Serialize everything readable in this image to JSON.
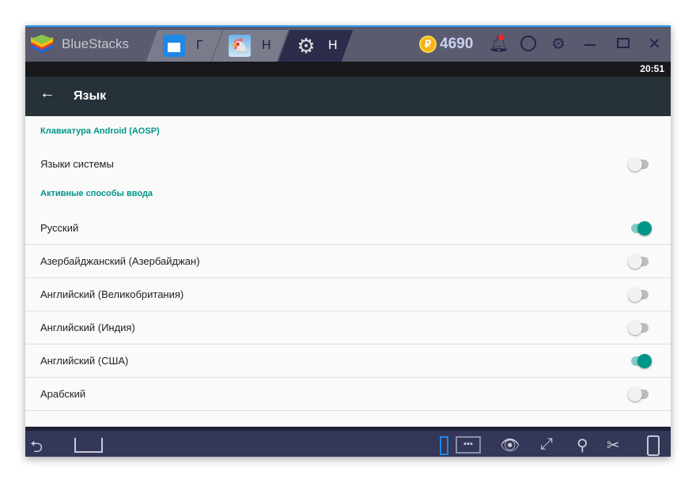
{
  "titlebar": {
    "brand": "BlueStacks",
    "tabs": [
      {
        "label": "Г",
        "icon": "home-icon"
      },
      {
        "label": "Н",
        "icon": "chicken-game-icon"
      },
      {
        "label": "Н",
        "icon": "settings-gear-icon"
      }
    ],
    "coins": "4690",
    "coin_symbol": "₽"
  },
  "status": {
    "time": "20:51"
  },
  "appbar": {
    "title": "Язык"
  },
  "content": {
    "section1": "Клавиатура Android (AOSP)",
    "system_languages": {
      "label": "Языки системы",
      "on": false
    },
    "section2": "Активные способы ввода",
    "items": [
      {
        "label": "Русский",
        "on": true
      },
      {
        "label": "Азербайджанский (Азербайджан)",
        "on": false
      },
      {
        "label": "Английский (Великобритания)",
        "on": false
      },
      {
        "label": "Английский (Индия)",
        "on": false
      },
      {
        "label": "Английский (США)",
        "on": true
      },
      {
        "label": "Арабский",
        "on": false
      }
    ]
  },
  "colors": {
    "accent": "#009688",
    "appbar": "#263238",
    "titlebar": "#5a5b6e",
    "navbar": "#343757"
  }
}
